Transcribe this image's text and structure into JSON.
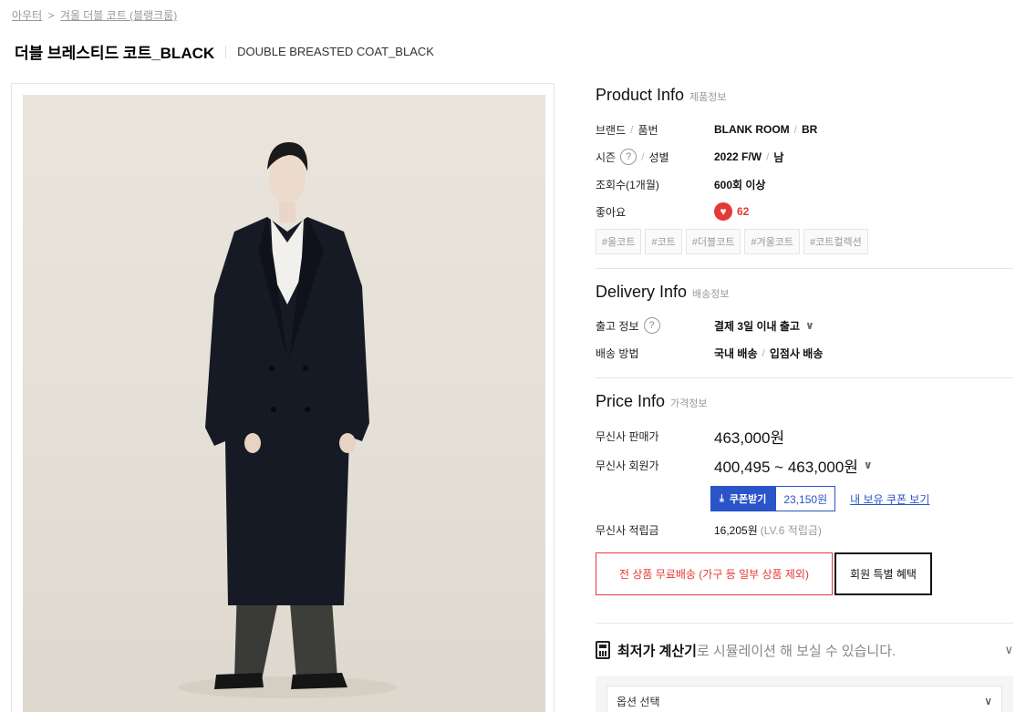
{
  "breadcrumb": {
    "category": "아우터",
    "separator": ">",
    "subcategory": "겨울 더블 코트 (블랭크룸)"
  },
  "product": {
    "title_ko": "더블 브레스티드 코트_BLACK",
    "title_en": "DOUBLE BREASTED COAT_BLACK"
  },
  "product_info": {
    "title": "Product Info",
    "subtitle": "제품정보",
    "brand_label": "브랜드",
    "code_label": "품번",
    "brand_value": "BLANK ROOM",
    "code_value": "BR",
    "season_label": "시즌",
    "gender_label": "성별",
    "season_value": "2022 F/W",
    "gender_value": "남",
    "views_label": "조회수(1개월)",
    "views_value": "600회 이상",
    "likes_label": "좋아요",
    "likes_value": "62",
    "tags": [
      "#울코트",
      "#코트",
      "#더블코트",
      "#겨울코트",
      "#코트컬렉션"
    ]
  },
  "delivery_info": {
    "title": "Delivery Info",
    "subtitle": "배송정보",
    "ship_label": "출고 정보",
    "ship_value": "결제 3일 이내 출고",
    "method_label": "배송 방법",
    "method_value_1": "국내 배송",
    "method_value_2": "입점사 배송"
  },
  "price_info": {
    "title": "Price Info",
    "subtitle": "가격정보",
    "sale_label": "무신사 판매가",
    "sale_value": "463,000원",
    "member_label": "무신사 회원가",
    "member_value": "400,495 ~ 463,000원",
    "coupon_button": "쿠폰받기",
    "coupon_amount": "23,150원",
    "coupon_link": "내 보유 쿠폰 보기",
    "points_label": "무신사 적립금",
    "points_value": "16,205원",
    "points_note": "(LV.6 적립금)",
    "free_shipping": "전 상품 무료배송 (가구 등 일부 상품 제외)",
    "member_benefit": "회원 특별 혜택"
  },
  "calculator": {
    "bold": "최저가 계산기",
    "rest": "로 시뮬레이션 해 보실 수 있습니다."
  },
  "option": {
    "placeholder": "옵션 선택"
  },
  "colors": {
    "accent_blue": "#2a54c8",
    "accent_red": "#e53935"
  },
  "icons": {
    "help": "question-circle-icon",
    "heart": "heart-icon",
    "download": "download-icon",
    "chevron": "chevron-down-icon",
    "calculator": "calculator-icon"
  }
}
